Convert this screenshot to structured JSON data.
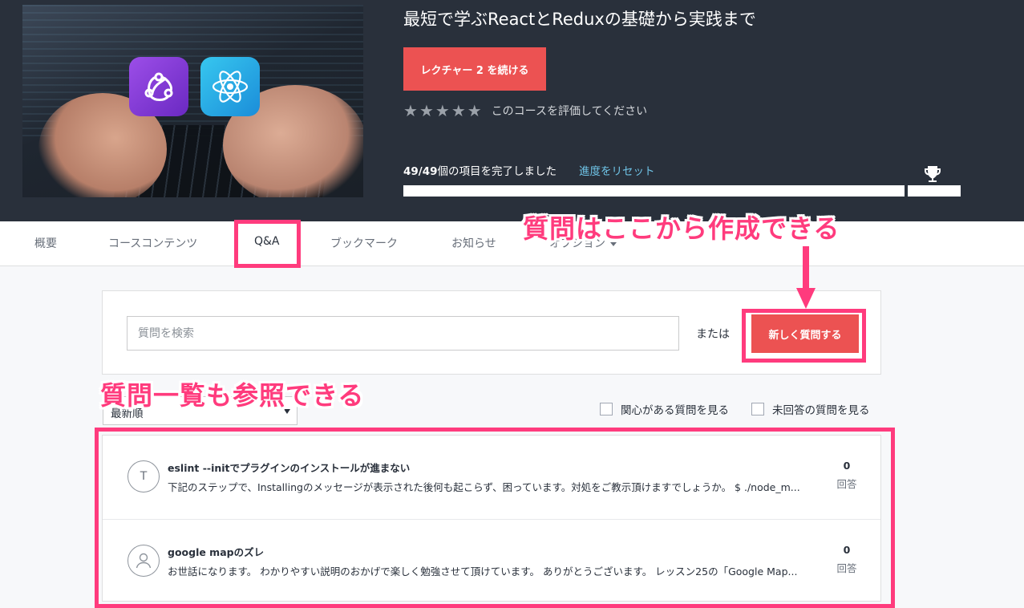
{
  "course": {
    "title": "最短で学ぶReactとReduxの基礎から実践まで",
    "continue_label": "レクチャー 2 を続ける",
    "rating_prompt": "このコースを評価してください",
    "rating_stars": 5,
    "progress_count": "49/49",
    "progress_suffix": "個の項目を完了しました",
    "progress_fraction": 1.0,
    "reset_label": "進度をリセット",
    "thumbnail_icons": [
      "redux-logo-icon",
      "react-logo-icon"
    ]
  },
  "tabs": [
    {
      "label": "概要"
    },
    {
      "label": "コースコンテンツ"
    },
    {
      "label": "Q&A"
    },
    {
      "label": "ブックマーク"
    },
    {
      "label": "お知らせ"
    },
    {
      "label": "オプション"
    }
  ],
  "qa": {
    "search_placeholder": "質問を検索",
    "or_label": "または",
    "ask_button": "新しく質問する",
    "sort_label": "最新順",
    "filter_following": "関心がある質問を見る",
    "filter_unanswered": "未回答の質問を見る",
    "questions": [
      {
        "avatar": "T",
        "title": "eslint --initでプラグインのインストールが進まない",
        "body": "下記のステップで、Installingのメッセージが表示された後何も起こらず、困っています。対処をご教示頂けますでしょうか。 $ ./node_m...",
        "answers": "0",
        "answers_label": "回答"
      },
      {
        "avatar": "user-icon",
        "title": "google mapのズレ",
        "body": "お世話になります。 わかりやすい説明のおかげで楽しく勉強させて頂けています。 ありがとうございます。 レッスン25の「Google Map...",
        "answers": "0",
        "answers_label": "回答"
      }
    ]
  },
  "annotations": {
    "create_here": "質問はここから作成できる",
    "list_here": "質問一覧も参照できる"
  },
  "colors": {
    "header_bg": "#29303b",
    "accent_red": "#ec5252",
    "link_blue": "#6fc3e6",
    "annotation_pink": "#ff3b7d"
  }
}
